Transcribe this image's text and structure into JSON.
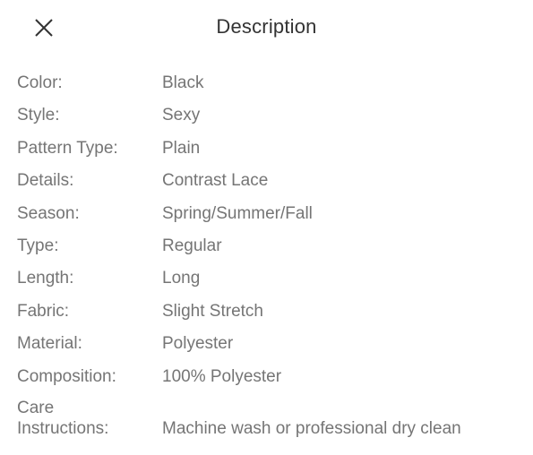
{
  "header": {
    "title": "Description",
    "close_icon": "close-icon"
  },
  "attributes": [
    {
      "label": "Color:",
      "value": "Black"
    },
    {
      "label": "Style:",
      "value": "Sexy"
    },
    {
      "label": "Pattern Type:",
      "value": "Plain"
    },
    {
      "label": "Details:",
      "value": "Contrast Lace"
    },
    {
      "label": "Season:",
      "value": "Spring/Summer/Fall"
    },
    {
      "label": "Type:",
      "value": "Regular"
    },
    {
      "label": "Length:",
      "value": "Long"
    },
    {
      "label": "Fabric:",
      "value": "Slight Stretch"
    },
    {
      "label": "Material:",
      "value": "Polyester"
    },
    {
      "label": "Composition:",
      "value": "100% Polyester"
    },
    {
      "label_line1": "Care",
      "label_line2": "Instructions:",
      "value": "Machine wash or professional dry clean"
    }
  ]
}
